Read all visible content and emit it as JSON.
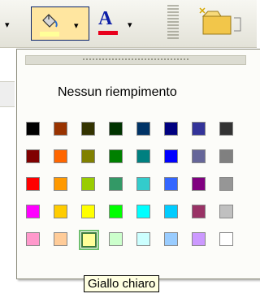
{
  "toolbar": {
    "fill_color_bar": "#ffff99",
    "font_color_letter": "A",
    "font_color_bar": "#e8001c",
    "icons": [
      "paint-bucket-icon",
      "font-color-icon",
      "open-folder-icon"
    ]
  },
  "palette": {
    "no_fill_label": "Nessun riempimento",
    "rows": [
      [
        "#000000",
        "#993300",
        "#333300",
        "#003300",
        "#003366",
        "#000080",
        "#333399",
        "#333333"
      ],
      [
        "#800000",
        "#ff6600",
        "#808000",
        "#008000",
        "#008080",
        "#0000ff",
        "#666699",
        "#808080"
      ],
      [
        "#ff0000",
        "#ff9900",
        "#99cc00",
        "#339966",
        "#33cccc",
        "#3366ff",
        "#800080",
        "#969696"
      ],
      [
        "#ff00ff",
        "#ffcc00",
        "#ffff00",
        "#00ff00",
        "#00ffff",
        "#00ccff",
        "#993366",
        "#c0c0c0"
      ],
      [
        "#ff99cc",
        "#ffcc99",
        "#ffff99",
        "#ccffcc",
        "#ccffff",
        "#99ccff",
        "#cc99ff",
        "#ffffff"
      ]
    ],
    "selected": {
      "row": 4,
      "col": 2
    }
  },
  "tooltip": {
    "text": "Giallo chiaro"
  }
}
